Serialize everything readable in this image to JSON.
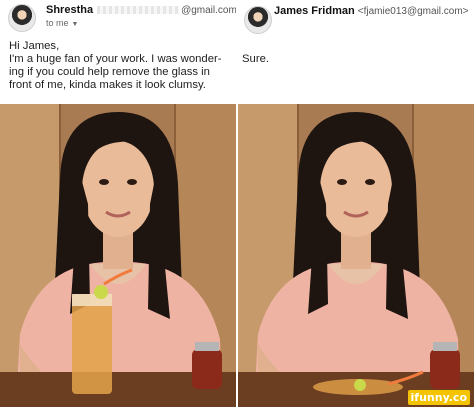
{
  "left_email": {
    "sender_name": "Shrestha",
    "sender_email_visible": "@gmail.com>",
    "recipient": "to me",
    "greeting": "Hi James,",
    "message": "I'm a huge fan of your work. I was wonder-ing if you could help remove the glass in front of me, kinda makes it look clumsy."
  },
  "right_email": {
    "sender_name": "James Fridman",
    "sender_email": "<fjamie013@gmail.com>",
    "message": "Sure."
  },
  "watermark": "ifunny.co",
  "colors": {
    "wall": "#b88b5f",
    "table": "#6b3e22",
    "shirt": "#f0b3a5",
    "watermark_bg": "#f5c400"
  },
  "icons": {
    "left_avatar": "user-avatar",
    "right_avatar": "user-avatar",
    "chevron": "chevron-down-icon"
  }
}
